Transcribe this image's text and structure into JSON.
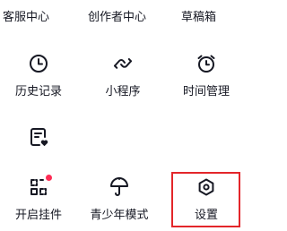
{
  "colors": {
    "text": "#161823",
    "badge": "#fe2c55",
    "highlight": "#e3262a"
  },
  "rows": [
    {
      "items": [
        {
          "label": "客服中心"
        },
        {
          "label": "创作者中心"
        },
        {
          "label": "草稿箱"
        }
      ]
    },
    {
      "items": [
        {
          "label": "历史记录",
          "icon": "clock-icon"
        },
        {
          "label": "小程序",
          "icon": "mini-program-icon"
        },
        {
          "label": "时间管理",
          "icon": "alarm-clock-icon"
        }
      ]
    },
    {
      "items": [
        {
          "label": "",
          "icon": "document-heart-icon"
        }
      ]
    },
    {
      "items": [
        {
          "label": "开启挂件",
          "icon": "widget-icon",
          "badge": true
        },
        {
          "label": "青少年模式",
          "icon": "umbrella-icon"
        },
        {
          "label": "设置",
          "icon": "settings-icon"
        }
      ]
    }
  ]
}
